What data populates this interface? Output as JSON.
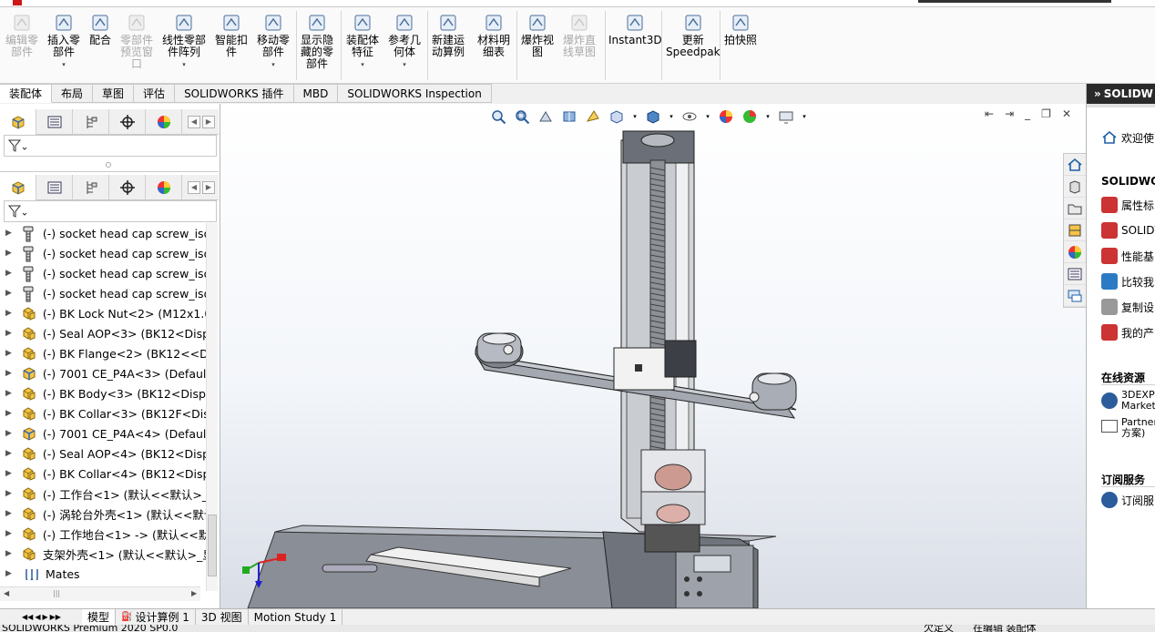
{
  "ribbon": {
    "buttons": [
      {
        "label1": "编辑零",
        "label2": "部件",
        "disabled": true,
        "icon": "edit-component-icon"
      },
      {
        "label1": "插入零",
        "label2": "部件",
        "dropdown": true,
        "icon": "insert-component-icon"
      },
      {
        "label1": "配合",
        "label2": "",
        "icon": "mate-icon"
      },
      {
        "label1": "零部件",
        "label2": "预览窗",
        "label3": "口",
        "disabled": true,
        "icon": "component-preview-icon"
      },
      {
        "label1": "线性零部",
        "label2": "件阵列",
        "dropdown": true,
        "icon": "linear-pattern-icon"
      },
      {
        "label1": "智能扣",
        "label2": "件",
        "icon": "smart-fasteners-icon"
      },
      {
        "label1": "移动零",
        "label2": "部件",
        "dropdown": true,
        "icon": "move-component-icon"
      },
      {
        "label1": "显示隐",
        "label2": "藏的零",
        "label3": "部件",
        "icon": "show-hidden-icon"
      },
      {
        "label1": "装配体",
        "label2": "特征",
        "dropdown": true,
        "icon": "assembly-features-icon"
      },
      {
        "label1": "参考几",
        "label2": "何体",
        "dropdown": true,
        "icon": "reference-geometry-icon"
      },
      {
        "label1": "新建运",
        "label2": "动算例",
        "icon": "new-motion-study-icon"
      },
      {
        "label1": "材料明",
        "label2": "细表",
        "icon": "bom-icon"
      },
      {
        "label1": "爆炸视",
        "label2": "图",
        "icon": "exploded-view-icon"
      },
      {
        "label1": "爆炸直",
        "label2": "线草图",
        "disabled": true,
        "icon": "explode-line-sketch-icon"
      },
      {
        "label1": "Instant3D",
        "label2": "",
        "icon": "instant3d-icon"
      },
      {
        "label1": "更新",
        "label2": "Speedpak",
        "icon": "speedpak-icon"
      },
      {
        "label1": "拍快照",
        "label2": "",
        "icon": "snapshot-icon"
      }
    ]
  },
  "tabs": [
    "装配体",
    "布局",
    "草图",
    "评估",
    "SOLIDWORKS 插件",
    "MBD",
    "SOLIDWORKS Inspection"
  ],
  "tree": {
    "items": [
      {
        "label": "(-) socket head cap screw_iso",
        "icon": "screw"
      },
      {
        "label": "(-) socket head cap screw_iso",
        "icon": "screw"
      },
      {
        "label": "(-) socket head cap screw_iso",
        "icon": "screw"
      },
      {
        "label": "(-) socket head cap screw_iso",
        "icon": "screw"
      },
      {
        "label": "(-) BK Lock Nut<2> (M12x1.0-",
        "icon": "asm"
      },
      {
        "label": "(-) Seal AOP<3> (BK12<Displa",
        "icon": "asm"
      },
      {
        "label": "(-) BK Flange<2> (BK12<<Def",
        "icon": "asm"
      },
      {
        "label": "(-) 7001 CE_P4A<3> (Default<",
        "icon": "part"
      },
      {
        "label": "(-) BK Body<3> (BK12<Displa",
        "icon": "asm"
      },
      {
        "label": "(-) BK Collar<3> (BK12F<Disp",
        "icon": "asm"
      },
      {
        "label": "(-) 7001 CE_P4A<4> (Default<",
        "icon": "part"
      },
      {
        "label": "(-) Seal AOP<4> (BK12<Displa",
        "icon": "asm"
      },
      {
        "label": "(-) BK Collar<4> (BK12<Displa",
        "icon": "asm"
      },
      {
        "label": "(-) 工作台<1> (默认<<默认>_显",
        "icon": "asm"
      },
      {
        "label": "(-) 涡轮台外壳<1> (默认<<默认",
        "icon": "asm"
      },
      {
        "label": "(-) 工作地台<1> -> (默认<<默认",
        "icon": "asm"
      },
      {
        "label": "支架外壳<1> (默认<<默认>_显",
        "icon": "asm"
      },
      {
        "label": "Mates",
        "icon": "mates"
      }
    ]
  },
  "bottom_tabs": [
    "模型",
    "设计算例 1",
    "3D 视图",
    "Motion Study 1"
  ],
  "status": {
    "left": "SOLIDWORKS Premium 2020 SP0.0",
    "right1": "欠定义",
    "right2": "在编辑 装配体"
  },
  "right_panel": {
    "header": "SOLIDW",
    "welcome": "欢迎使",
    "section1": "SOLIDWORK",
    "items1": [
      "属性标",
      "SOLIDV",
      "性能基",
      "比较我",
      "复制设",
      "我的产"
    ],
    "section2": "在线资源",
    "online1a": "3DEXPE",
    "online1b": "Market",
    "online2a": "Partner",
    "online2b": "方案)",
    "section3": "订阅服务",
    "sub1": "订阅服"
  },
  "colors": {
    "accent": "#1e5fa8",
    "dark_header": "#2a2a2a"
  }
}
